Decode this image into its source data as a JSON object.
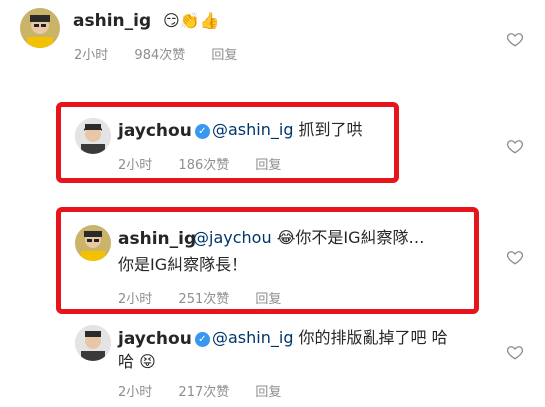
{
  "comments": [
    {
      "username": "ashin_ig",
      "verified": false,
      "mention": "",
      "text": "",
      "emoji": "😏👏👍",
      "time": "2小时",
      "likes": "984次赞",
      "reply": "回复"
    },
    {
      "username": "jaychou",
      "verified": true,
      "mention": "@ashin_ig",
      "text": " 抓到了哄",
      "time": "2小时",
      "likes": "186次赞",
      "reply": "回复"
    },
    {
      "username": "ashin_ig",
      "verified": false,
      "mention": "@jaychou",
      "emoji": "😂",
      "text": "你不是IG糾察隊…",
      "text2": "你是IG糾察隊長！",
      "time": "2小时",
      "likes": "251次赞",
      "reply": "回复"
    },
    {
      "username": "jaychou",
      "verified": true,
      "mention": "@ashin_ig",
      "text": " 你的排版亂掉了吧 哈",
      "text2": "哈",
      "emoji2": "😝",
      "time": "2小时",
      "likes": "217次赞",
      "reply": "回复"
    }
  ],
  "colors": {
    "highlight_box": "#e8141b",
    "verified_badge": "#3897f0",
    "mention": "#00376b",
    "meta": "#8e8e8e"
  },
  "icons": [
    "heart-outline-icon",
    "verified-badge-icon"
  ]
}
